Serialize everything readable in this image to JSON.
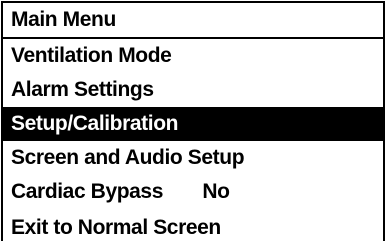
{
  "menu": {
    "title": "Main Menu",
    "items": [
      {
        "label": "Ventilation Mode",
        "value": "",
        "selected": false
      },
      {
        "label": "Alarm Settings",
        "value": "",
        "selected": false
      },
      {
        "label": "Setup/Calibration",
        "value": "",
        "selected": true
      },
      {
        "label": "Screen and Audio Setup",
        "value": "",
        "selected": false
      },
      {
        "label": "Cardiac Bypass",
        "value": "No",
        "selected": false
      },
      {
        "label": "Exit to Normal Screen",
        "value": "",
        "selected": false
      }
    ]
  },
  "colors": {
    "background": "#ffffff",
    "foreground": "#000000",
    "selection_background": "#000000",
    "selection_text": "#ffffff"
  }
}
